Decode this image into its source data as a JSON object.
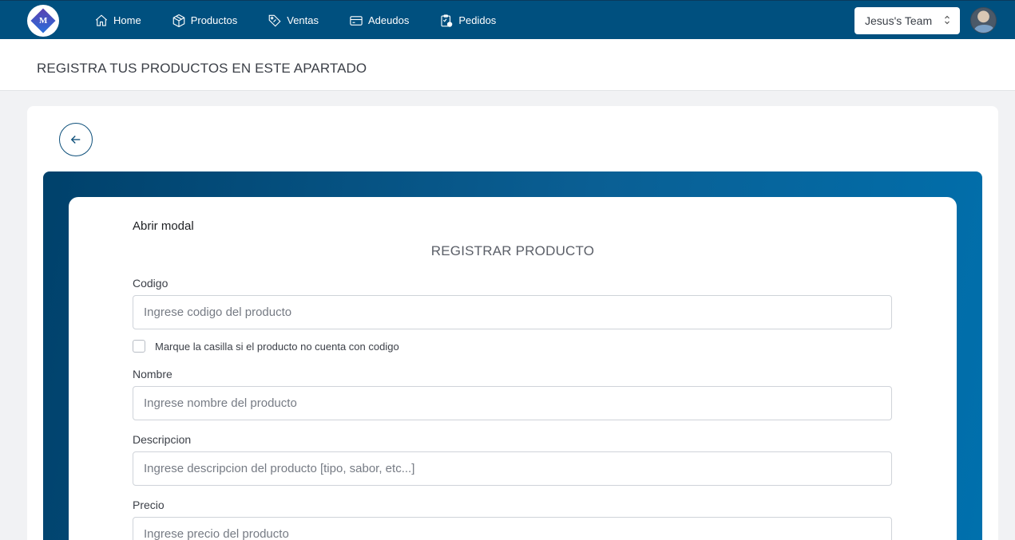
{
  "nav": {
    "logo_text": "M",
    "items": [
      {
        "label": "Home",
        "icon": "home-icon"
      },
      {
        "label": "Productos",
        "icon": "box-icon"
      },
      {
        "label": "Ventas",
        "icon": "tag-icon"
      },
      {
        "label": "Adeudos",
        "icon": "card-icon"
      },
      {
        "label": "Pedidos",
        "icon": "clipboard-icon"
      }
    ],
    "team": "Jesus's Team"
  },
  "page": {
    "title": "REGISTRA TUS PRODUCTOS EN ESTE APARTADO"
  },
  "form": {
    "modal_link": "Abrir modal",
    "title": "REGISTRAR PRODUCTO",
    "codigo": {
      "label": "Codigo",
      "placeholder": "Ingrese codigo del producto"
    },
    "no_code_checkbox": "Marque la casilla si el producto no cuenta con codigo",
    "nombre": {
      "label": "Nombre",
      "placeholder": "Ingrese nombre del producto"
    },
    "descripcion": {
      "label": "Descripcion",
      "placeholder": "Ingrese descripcion del producto [tipo, sabor, etc...]"
    },
    "precio": {
      "label": "Precio",
      "placeholder": "Ingrese precio del producto"
    }
  },
  "colors": {
    "navbar": "#00507f",
    "accent": "#0d4f7a"
  }
}
